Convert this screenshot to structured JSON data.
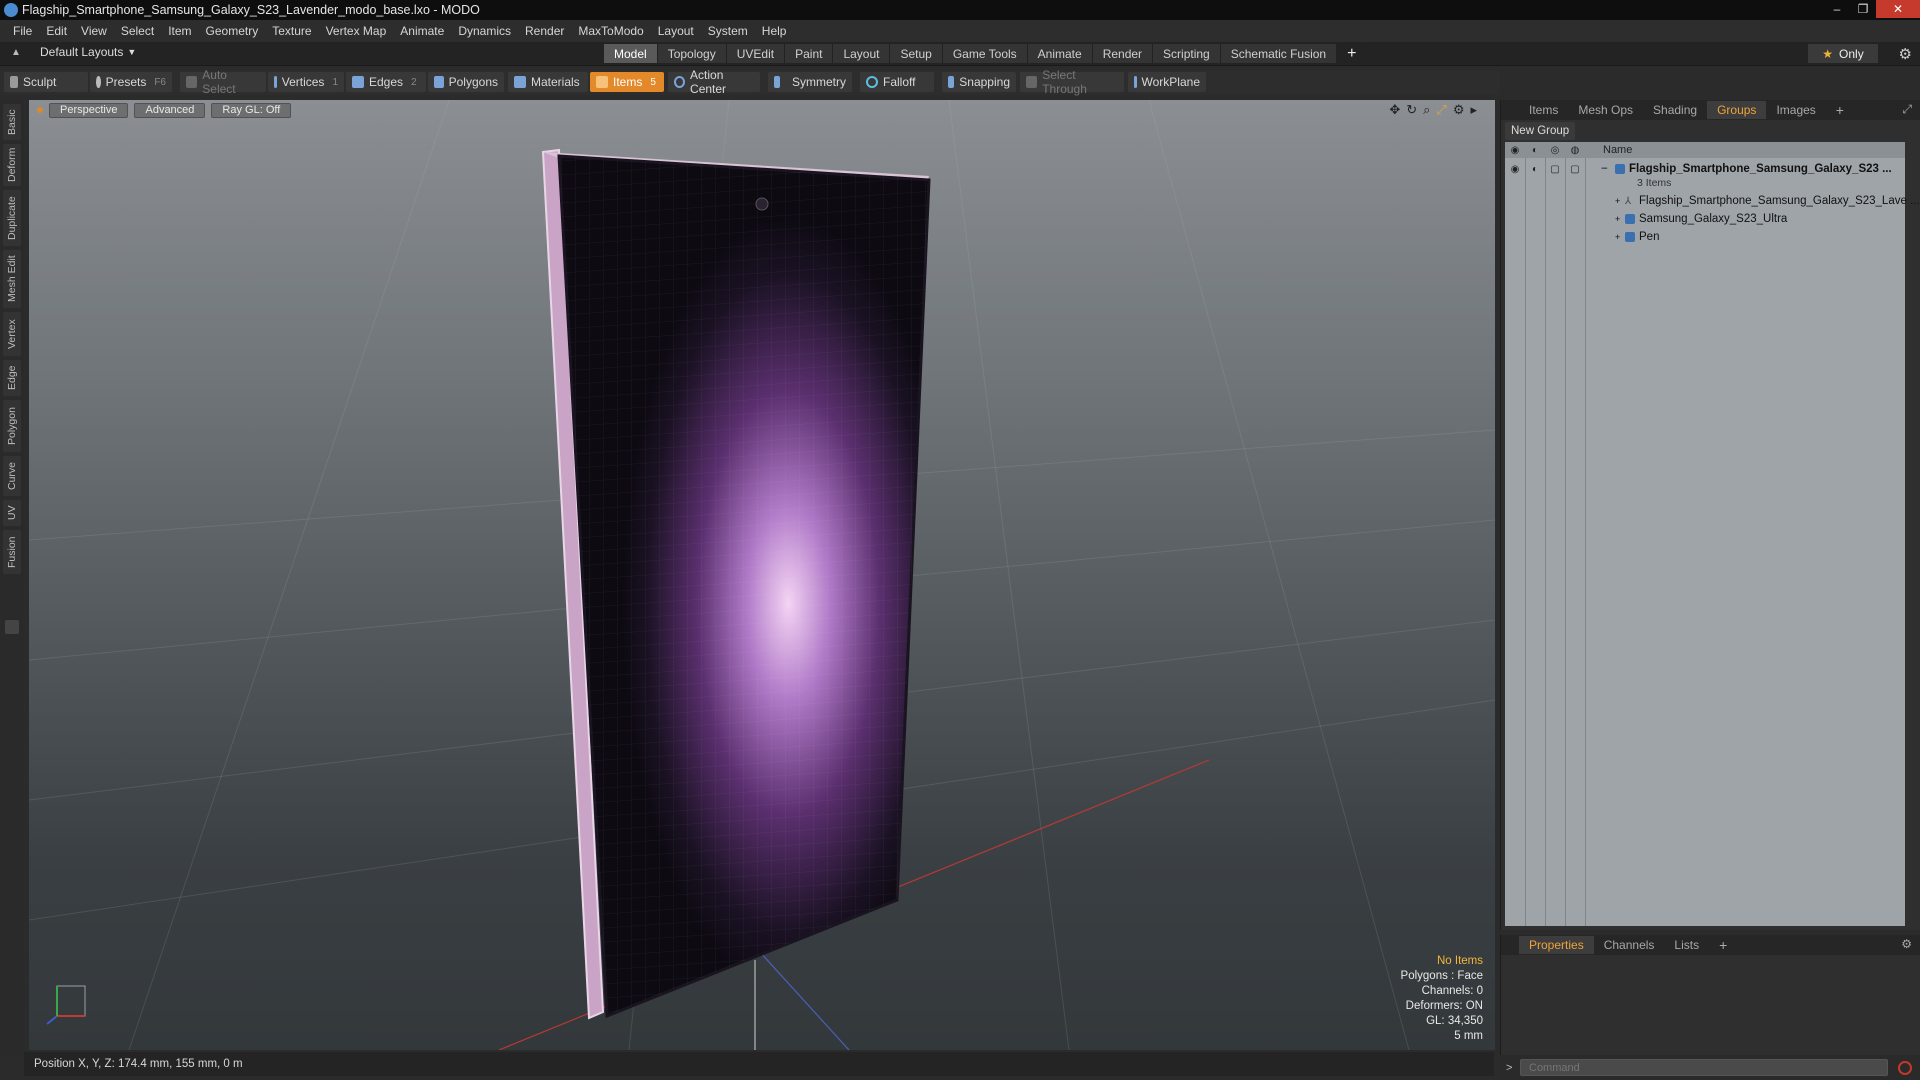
{
  "window": {
    "title": "Flagship_Smartphone_Samsung_Galaxy_S23_Lavender_modo_base.lxo - MODO",
    "controls": {
      "minimize": "–",
      "maximize": "❐",
      "close": "✕"
    }
  },
  "menu": [
    "File",
    "Edit",
    "View",
    "Select",
    "Item",
    "Geometry",
    "Texture",
    "Vertex Map",
    "Animate",
    "Dynamics",
    "Render",
    "MaxToModo",
    "Layout",
    "System",
    "Help"
  ],
  "layout": {
    "selector": "Default Layouts",
    "tabs": [
      "Model",
      "Topology",
      "UVEdit",
      "Paint",
      "Layout",
      "Setup",
      "Game Tools",
      "Animate",
      "Render",
      "Scripting",
      "Schematic Fusion"
    ],
    "active_tab": "Model",
    "add": "+",
    "only": "Only"
  },
  "toolbar": {
    "sculpt": "Sculpt",
    "presets": "Presets",
    "presets_key": "F6",
    "auto_select": "Auto Select",
    "vertices": "Vertices",
    "vertices_key": "1",
    "edges": "Edges",
    "edges_key": "2",
    "polygons": "Polygons",
    "materials": "Materials",
    "items": "Items",
    "items_key": "5",
    "action_center": "Action Center",
    "symmetry": "Symmetry",
    "falloff": "Falloff",
    "snapping": "Snapping",
    "select_through": "Select Through",
    "workplane": "WorkPlane"
  },
  "left_tabs": [
    "Basic",
    "Deform",
    "Duplicate",
    "Mesh Edit",
    "Vertex",
    "Edge",
    "Polygon",
    "Curve",
    "UV",
    "Fusion"
  ],
  "viewport": {
    "view": "Perspective",
    "shading": "Advanced",
    "raygl": "Ray GL: Off",
    "hud": {
      "selection": "No Items",
      "polygons": "Polygons : Face",
      "channels": "Channels: 0",
      "deformers": "Deformers: ON",
      "gl": "GL: 34,350",
      "grid": "5 mm"
    }
  },
  "status": {
    "position": "Position X, Y, Z:   174.4 mm, 155 mm, 0 m"
  },
  "item_panel": {
    "tabs": [
      "Items",
      "Mesh Ops",
      "Shading",
      "Groups",
      "Images"
    ],
    "active_tab": "Groups",
    "new_group": "New Group",
    "column_name": "Name",
    "group": {
      "name": "Flagship_Smartphone_Samsung_Galaxy_S23 ...",
      "count": "3 Items",
      "children": [
        "Flagship_Smartphone_Samsung_Galaxy_S23_Lave ...",
        "Samsung_Galaxy_S23_Ultra",
        "Pen"
      ]
    }
  },
  "props_panel": {
    "tabs": [
      "Properties",
      "Channels",
      "Lists"
    ],
    "active_tab": "Properties"
  },
  "command": {
    "placeholder": "Command"
  },
  "colors": {
    "accent": "#e3892a",
    "active_tab_text": "#f0a33a",
    "hud_warning": "#f2b63c"
  }
}
